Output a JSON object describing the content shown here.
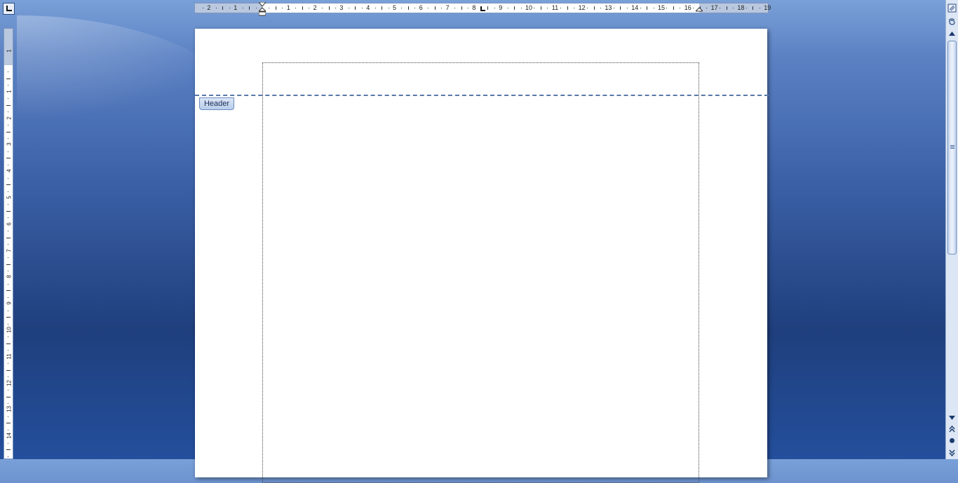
{
  "ruler": {
    "horizontal_numbers_left": [
      "2",
      "1"
    ],
    "horizontal_numbers": [
      "1",
      "2",
      "3",
      "4",
      "5",
      "6",
      "7",
      "8",
      "9",
      "10",
      "11",
      "12",
      "13",
      "14",
      "15",
      "16",
      "17",
      "18",
      "19"
    ],
    "vertical_numbers_top": [
      "1"
    ],
    "vertical_numbers": [
      "1",
      "2",
      "3",
      "4",
      "5",
      "6",
      "7",
      "8",
      "9",
      "10",
      "11",
      "12",
      "13",
      "14"
    ]
  },
  "header": {
    "label": "Header"
  },
  "colors": {
    "accent": "#3d62a8",
    "header_line": "#5878a8"
  },
  "icons": {
    "tab_selector": "left-tab-icon",
    "scroll_up": "triangle-up-icon",
    "scroll_down": "triangle-down-icon",
    "prev_page": "double-chevron-up-icon",
    "browse_object": "circle-icon",
    "next_page": "double-chevron-down-icon",
    "view_ruler": "ruler-icon"
  }
}
